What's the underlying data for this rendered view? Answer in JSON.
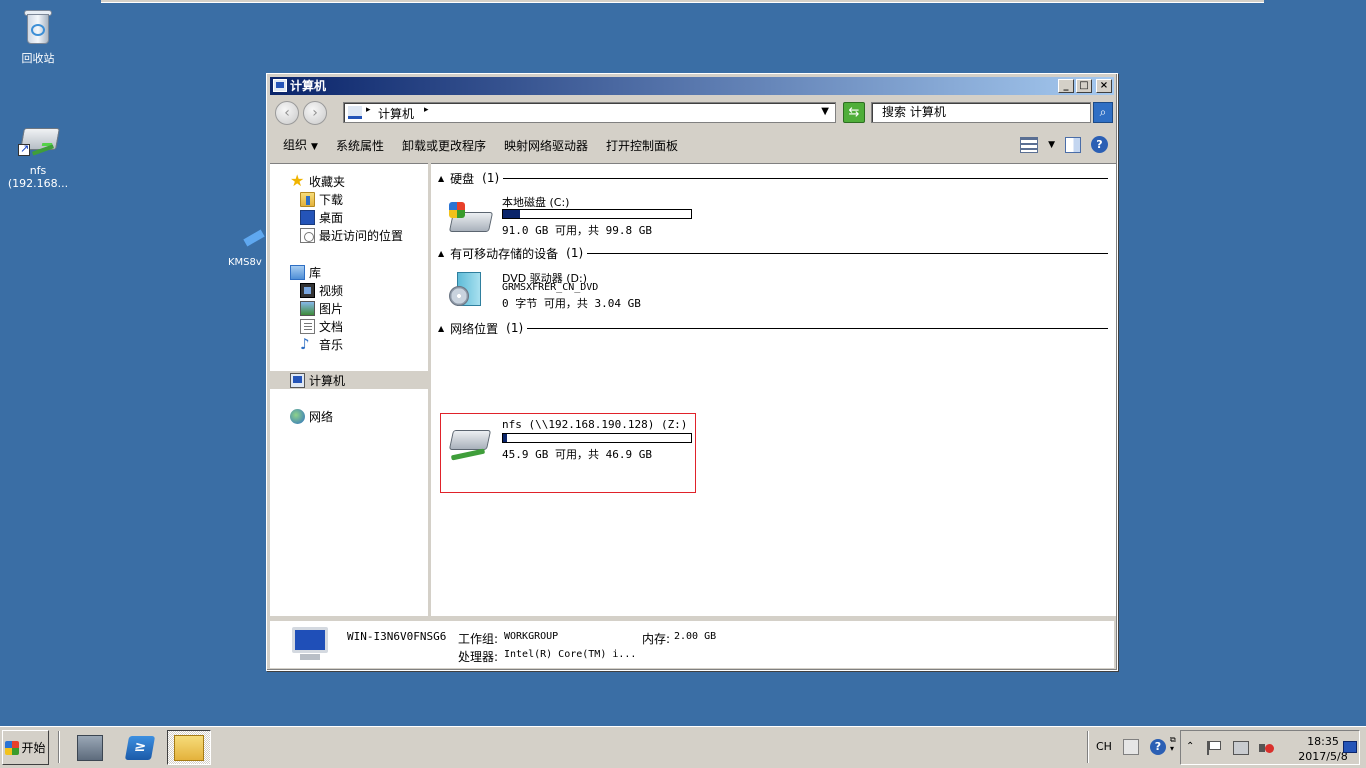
{
  "desktop": {
    "icons": [
      {
        "label": "回收站",
        "icon": "recycle-bin-icon"
      },
      {
        "label": "nfs\n(192.168...",
        "icon": "network-drive-icon"
      },
      {
        "label": "KMS8v",
        "icon": "shortcut-icon"
      }
    ]
  },
  "window": {
    "title": "计算机",
    "controls": {
      "minimize": "_",
      "maximize": "□",
      "close": "×"
    },
    "address": {
      "path": "计算机",
      "search_placeholder": "搜索 计算机"
    },
    "toolbar": {
      "items": [
        "组织",
        "系统属性",
        "卸载或更改程序",
        "映射网络驱动器",
        "打开控制面板"
      ]
    },
    "nav": {
      "favorites": "收藏夹",
      "favorites_items": [
        "下载",
        "桌面",
        "最近访问的位置"
      ],
      "library": "库",
      "library_items": [
        "视频",
        "图片",
        "文档",
        "音乐"
      ],
      "computer": "计算机",
      "network": "网络"
    },
    "groups": {
      "hdd": {
        "name": "硬盘",
        "count": "(1)"
      },
      "removable": {
        "name": "有可移动存储的设备",
        "count": "(1)"
      },
      "network": {
        "name": "网络位置",
        "count": "(1)"
      }
    },
    "drives": {
      "c": {
        "name": "本地磁盘 (C:)",
        "free": "91.0 GB 可用，共 99.8 GB",
        "used_fraction": 0.09
      },
      "d": {
        "name": "DVD 驱动器 (D:)",
        "label": "GRMSXFRER_CN_DVD",
        "free": "0 字节 可用，共 3.04 GB"
      },
      "z": {
        "name": "nfs (\\\\192.168.190.128) (Z:)",
        "free": "45.9 GB 可用，共 46.9 GB",
        "used_fraction": 0.02
      }
    },
    "details": {
      "computer_name": "WIN-I3N6V0FNSG6",
      "workgroup_label": "工作组:",
      "workgroup": "WORKGROUP",
      "memory_label": "内存:",
      "memory": "2.00 GB",
      "cpu_label": "处理器:",
      "cpu": "Intel(R) Core(TM) i..."
    }
  },
  "taskbar": {
    "start": "开始",
    "lang": "CH",
    "time": "18:35",
    "date": "2017/5/8"
  },
  "colors": {
    "desktop": "#3a6ea5",
    "titlebar_start": "#0a246a",
    "titlebar_end": "#a6caf0",
    "selection_border": "#e0222a"
  }
}
